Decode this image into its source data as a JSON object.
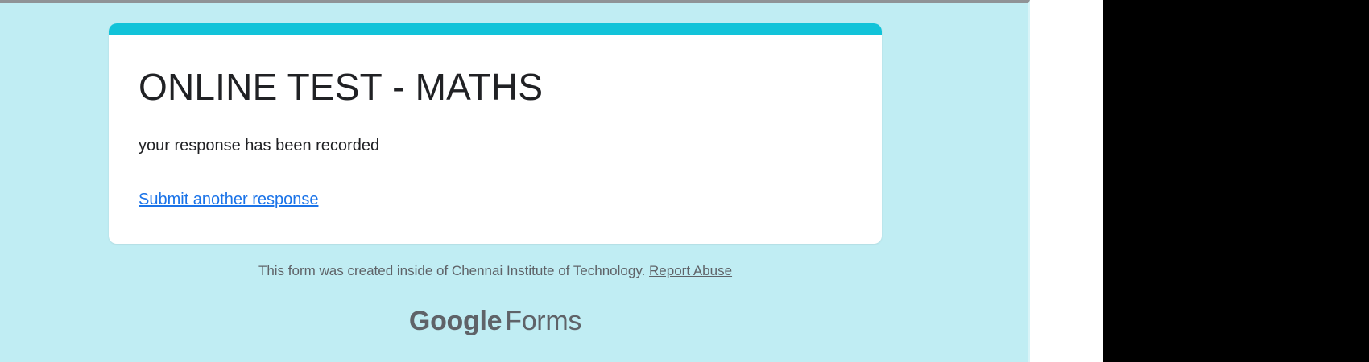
{
  "form": {
    "title": "ONLINE TEST - MATHS",
    "confirmation_message": "your response has been recorded",
    "submit_another_label": "Submit another response"
  },
  "footer": {
    "note": "This form was created inside of Chennai Institute of Technology.",
    "report_label": "Report Abuse",
    "logo_google": "Google",
    "logo_product": "Forms"
  },
  "colors": {
    "page_background": "#c0edf3",
    "accent": "#12c3d9",
    "link": "#1a73e8"
  }
}
